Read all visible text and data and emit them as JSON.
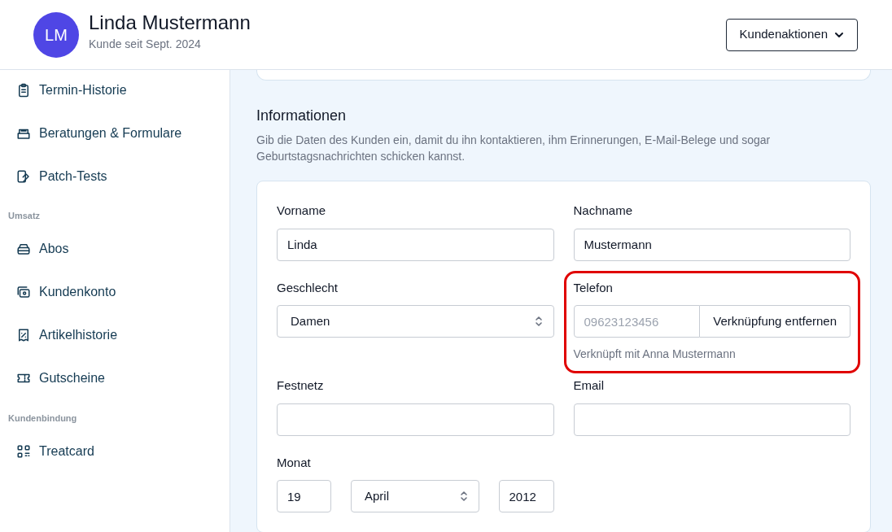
{
  "header": {
    "avatar_initials": "LM",
    "name": "Linda Mustermann",
    "subtitle": "Kunde seit Sept. 2024",
    "actions_button": "Kundenaktionen"
  },
  "sidebar": {
    "items": [
      {
        "kind": "item",
        "label": "Termin-Historie"
      },
      {
        "kind": "item",
        "label": "Beratungen & Formulare"
      },
      {
        "kind": "item",
        "label": "Patch-Tests"
      },
      {
        "kind": "section",
        "label": "Umsatz"
      },
      {
        "kind": "item",
        "label": "Abos"
      },
      {
        "kind": "item",
        "label": "Kundenkonto"
      },
      {
        "kind": "item",
        "label": "Artikelhistorie"
      },
      {
        "kind": "item",
        "label": "Gutscheine"
      },
      {
        "kind": "section",
        "label": "Kundenbindung"
      },
      {
        "kind": "item",
        "label": "Treatcard"
      }
    ]
  },
  "section": {
    "title": "Informationen",
    "description": "Gib die Daten des Kunden ein, damit du ihn kontaktieren, ihm Erinnerungen, E-Mail-Belege und sogar Geburtstagsnachrichten schicken kannst.",
    "fields": [
      {
        "kind": "text",
        "label": "Vorname",
        "value": "Linda"
      },
      {
        "kind": "text",
        "label": "Nachname",
        "value": "Mustermann"
      },
      {
        "kind": "select",
        "label": "Geschlecht",
        "value": "Damen"
      },
      {
        "kind": "phone",
        "label": "Telefon",
        "placeholder": "09623123456",
        "button": "Verknüpfung entfernen",
        "note": "Verknüpft mit Anna Mustermann",
        "highlighted": true
      },
      {
        "kind": "text",
        "label": "Festnetz"
      },
      {
        "kind": "text",
        "label": "Email"
      },
      {
        "kind": "date",
        "label": "Monat",
        "day": "19",
        "month": "April",
        "year": "2012"
      }
    ]
  }
}
